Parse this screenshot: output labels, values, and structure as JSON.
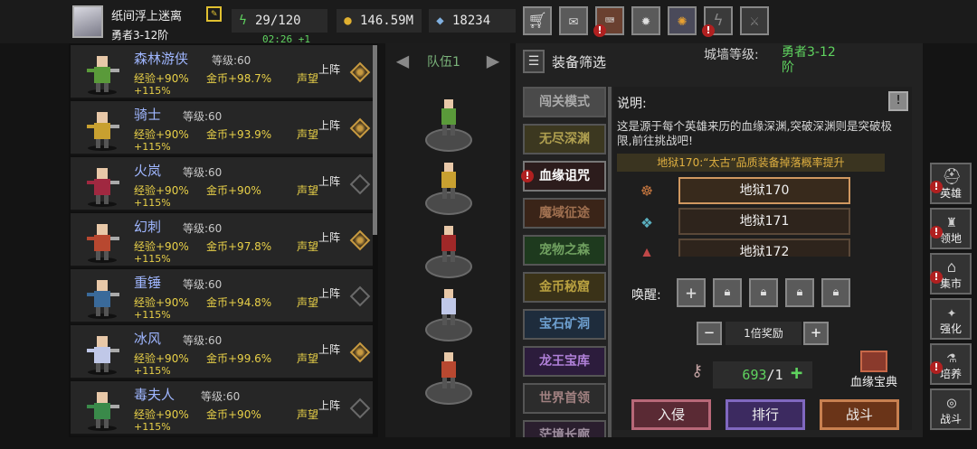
{
  "player": {
    "name": "纸间浮上迷离",
    "rank": "勇者3-12阶",
    "stamina": "29/120",
    "stamina_timer": "02:26 +1",
    "gold": "146.59M",
    "gems": "18234"
  },
  "top_buttons": [
    "shopping-cart-icon",
    "mail-icon",
    "gamepad-icon",
    "gear-icon",
    "aperture-icon",
    "lightning-icon",
    "sword-icon"
  ],
  "heroes": [
    {
      "name": "森林游侠",
      "level": "等级:60",
      "exp": "经验+90%",
      "gold": "金币+98.7%",
      "rep": "声望",
      "extra": "+115%",
      "deploy": "上阵",
      "selected": true,
      "color": "#5a9a3a"
    },
    {
      "name": "骑士",
      "level": "等级:60",
      "exp": "经验+90%",
      "gold": "金币+93.9%",
      "rep": "声望",
      "extra": "+115%",
      "deploy": "上阵",
      "selected": true,
      "color": "#c8a030"
    },
    {
      "name": "火岚",
      "level": "等级:60",
      "exp": "经验+90%",
      "gold": "金币+90%",
      "rep": "声望",
      "extra": "+115%",
      "deploy": "上阵",
      "selected": false,
      "color": "#a02840"
    },
    {
      "name": "幻刺",
      "level": "等级:60",
      "exp": "经验+90%",
      "gold": "金币+97.8%",
      "rep": "声望",
      "extra": "+115%",
      "deploy": "上阵",
      "selected": true,
      "color": "#b84830"
    },
    {
      "name": "重锤",
      "level": "等级:60",
      "exp": "经验+90%",
      "gold": "金币+94.8%",
      "rep": "声望",
      "extra": "+115%",
      "deploy": "上阵",
      "selected": false,
      "color": "#3a6a9a"
    },
    {
      "name": "冰风",
      "level": "等级:60",
      "exp": "经验+90%",
      "gold": "金币+99.6%",
      "rep": "声望",
      "extra": "+115%",
      "deploy": "上阵",
      "selected": true,
      "color": "#c0c8e8"
    },
    {
      "name": "毒夫人",
      "level": "等级:60",
      "exp": "经验+90%",
      "gold": "金币+90%",
      "rep": "声望",
      "extra": "+115%",
      "deploy": "上阵",
      "selected": false,
      "color": "#3a8a4a"
    }
  ],
  "team": {
    "label": "队伍1",
    "members": [
      "#5a9a3a",
      "#c8a030",
      "#a02828",
      "#c0c8e8",
      "#b84830"
    ]
  },
  "filter": {
    "label": "装备筛选"
  },
  "wall": {
    "label": "城墙等级:",
    "value": "勇者3-12阶"
  },
  "modes": [
    {
      "label": "闯关模式",
      "alert": false
    },
    {
      "label": "无尽深渊",
      "alert": false
    },
    {
      "label": "血缘诅咒",
      "alert": true
    },
    {
      "label": "魔域征途",
      "alert": false
    },
    {
      "label": "宠物之森",
      "alert": false
    },
    {
      "label": "金币秘窟",
      "alert": false
    },
    {
      "label": "宝石矿洞",
      "alert": false
    },
    {
      "label": "龙王宝库",
      "alert": false
    },
    {
      "label": "世界首领",
      "alert": false
    },
    {
      "label": "茫境长廊",
      "alert": false
    }
  ],
  "description": {
    "title": "说明:",
    "text": "这是源于每个英雄来历的血缘深渊,突破深渊则是突破极限,前往挑战吧!",
    "note": "地狱170:“太古”品质装备掉落概率提升"
  },
  "hells": [
    {
      "label": "地狱170",
      "selected": true
    },
    {
      "label": "地狱171",
      "selected": false
    },
    {
      "label": "地狱172",
      "selected": false
    }
  ],
  "awaken": {
    "label": "唤醒:"
  },
  "reward": {
    "label": "1倍奖励"
  },
  "keys": {
    "current": "693",
    "total": "/1"
  },
  "codex": {
    "label": "血缘宝典"
  },
  "actions": {
    "invade": "入侵",
    "rank": "排行",
    "fight": "战斗"
  },
  "sidebar": [
    {
      "label": "英雄",
      "icon": "helmet-icon",
      "alert": true
    },
    {
      "label": "领地",
      "icon": "castle-icon",
      "alert": true
    },
    {
      "label": "集市",
      "icon": "market-icon",
      "alert": true
    },
    {
      "label": "强化",
      "icon": "rune-icon",
      "alert": false
    },
    {
      "label": "培养",
      "icon": "potion-icon",
      "alert": true
    },
    {
      "label": "战斗",
      "icon": "portal-icon",
      "alert": false
    }
  ]
}
